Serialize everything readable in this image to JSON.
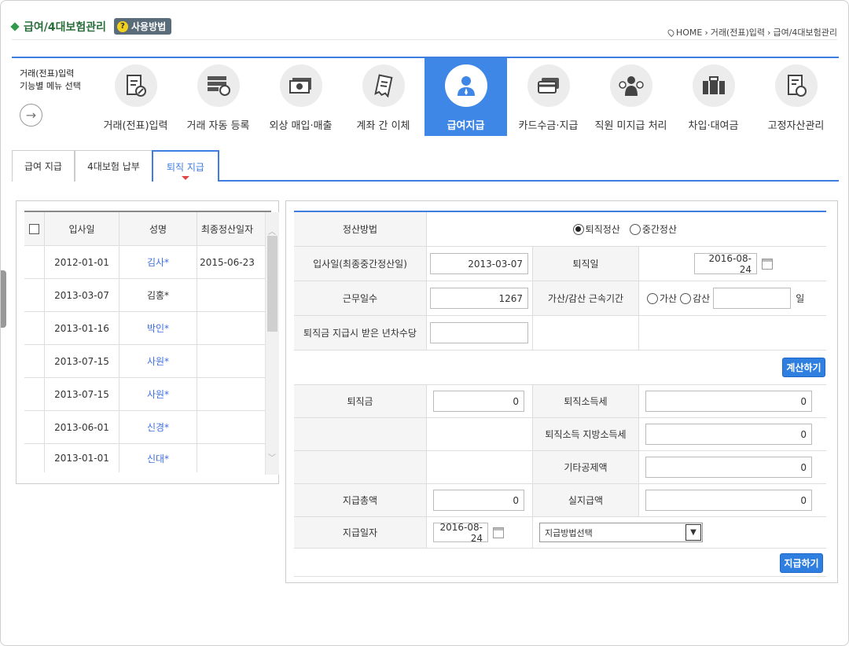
{
  "header": {
    "title": "급여/4대보험관리",
    "help_label": "사용방법",
    "breadcrumb": [
      "HOME",
      "거래(전표)입력",
      "급여/4대보험관리"
    ]
  },
  "menu": {
    "label_line1": "거래(전표)입력",
    "label_line2": "기능별 메뉴 선택",
    "items": [
      {
        "label": "거래(전표)입력",
        "icon": "document-edit-icon"
      },
      {
        "label": "거래 자동 등록",
        "icon": "server-sync-icon"
      },
      {
        "label": "외상 매입·매출",
        "icon": "cash-icon"
      },
      {
        "label": "계좌 간 이체",
        "icon": "receipt-icon"
      },
      {
        "label": "급여지급",
        "icon": "person-icon",
        "active": true
      },
      {
        "label": "카드수금·지급",
        "icon": "credit-card-icon"
      },
      {
        "label": "직원 미지급 처리",
        "icon": "employee-balance-icon"
      },
      {
        "label": "차입·대여금",
        "icon": "briefcase-icon"
      },
      {
        "label": "고정자산관리",
        "icon": "asset-document-icon"
      }
    ]
  },
  "tabs": [
    {
      "label": "급여 지급"
    },
    {
      "label": "4대보험 납부"
    },
    {
      "label": "퇴직 지급",
      "active": true
    }
  ],
  "employee_table": {
    "headers": [
      "입사일",
      "성명",
      "최종정산일자"
    ],
    "rows": [
      {
        "join": "2012-01-01",
        "name": "김사*",
        "settle": "2015-06-23"
      },
      {
        "join": "2013-03-07",
        "name": "김홍*",
        "settle": ""
      },
      {
        "join": "2013-01-16",
        "name": "박인*",
        "settle": ""
      },
      {
        "join": "2013-07-15",
        "name": "사원*",
        "settle": ""
      },
      {
        "join": "2013-07-15",
        "name": "사원*",
        "settle": ""
      },
      {
        "join": "2013-06-01",
        "name": "신경*",
        "settle": ""
      },
      {
        "join": "2013-01-01",
        "name": "신대*",
        "settle": ""
      }
    ]
  },
  "form": {
    "method_label": "정산방법",
    "method_opt1": "퇴직정산",
    "method_opt2": "중간정산",
    "join_label": "입사일(최종중간정산일)",
    "join_value": "2013-03-07",
    "retire_label": "퇴직일",
    "retire_value": "2016-08-24",
    "days_label": "근무일수",
    "days_value": "1267",
    "adjust_label": "가산/감산 근속기간",
    "adjust_opt1": "가산",
    "adjust_opt2": "감산",
    "adjust_unit": "일",
    "annual_label": "퇴직금 지급시 받은 년차수당",
    "calc_button": "계산하기",
    "severance_label": "퇴직금",
    "severance_value": "0",
    "tax_label": "퇴직소득세",
    "tax_value": "0",
    "local_tax_label": "퇴직소득 지방소득세",
    "local_tax_value": "0",
    "other_label": "기타공제액",
    "other_value": "0",
    "total_label": "지급총액",
    "total_value": "0",
    "net_label": "실지급액",
    "net_value": "0",
    "paydate_label": "지급일자",
    "paydate_value": "2016-08-24",
    "paymethod_placeholder": "지급방법선택",
    "pay_button": "지급하기"
  }
}
